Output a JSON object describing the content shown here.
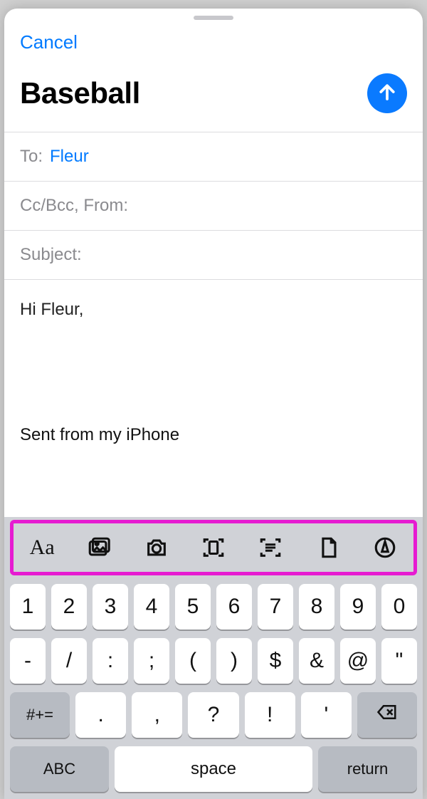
{
  "nav": {
    "cancel": "Cancel"
  },
  "compose": {
    "title": "Baseball",
    "to_label": "To:",
    "to_value": "Fleur",
    "ccbcc_label": "Cc/Bcc, From:",
    "ccbcc_value": "",
    "subject_label": "Subject:",
    "subject_value": "",
    "body_greeting": "Hi Fleur,",
    "signature": "Sent from my iPhone"
  },
  "toolbar_icons": {
    "format": "text-format-icon",
    "photos": "photo-library-icon",
    "camera": "camera-icon",
    "scan": "document-scan-icon",
    "scan_text": "scan-text-icon",
    "attach": "attach-file-icon",
    "markup": "markup-icon"
  },
  "keyboard": {
    "row1": [
      "1",
      "2",
      "3",
      "4",
      "5",
      "6",
      "7",
      "8",
      "9",
      "0"
    ],
    "row2": [
      "-",
      "/",
      ":",
      ";",
      "(",
      ")",
      "$",
      "&",
      "@",
      "\""
    ],
    "row3_mode": "#+=",
    "row3": [
      ".",
      ",",
      "?",
      "!",
      "'"
    ],
    "bottom": {
      "abc": "ABC",
      "space": "space",
      "return": "return"
    }
  }
}
